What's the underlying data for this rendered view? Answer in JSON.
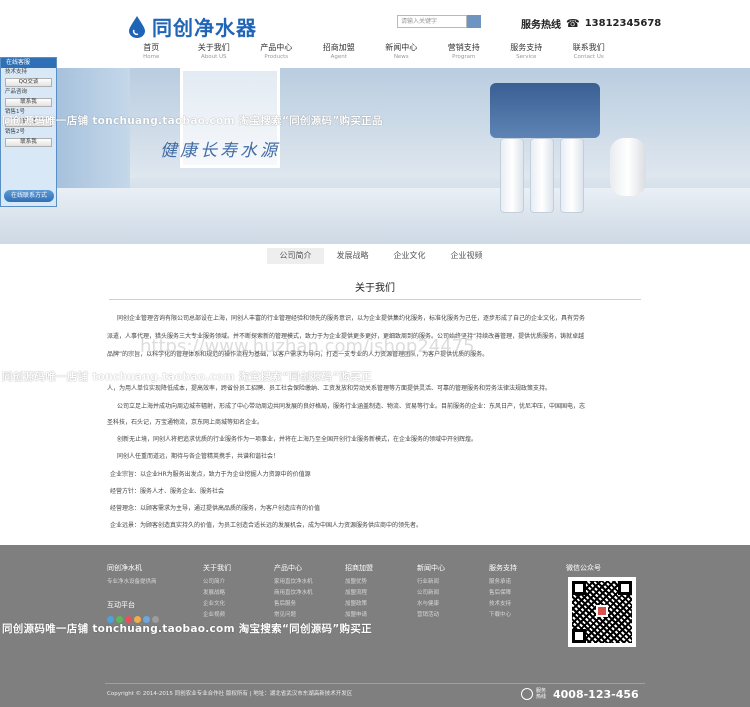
{
  "header": {
    "brand": "同创净水器",
    "search_placeholder": "请输入关键字",
    "hotline_label": "服务热线",
    "hotline_number": "13812345678"
  },
  "nav": [
    {
      "cn": "首页",
      "en": "Home"
    },
    {
      "cn": "关于我们",
      "en": "About US"
    },
    {
      "cn": "产品中心",
      "en": "Products"
    },
    {
      "cn": "招商加盟",
      "en": "Agent"
    },
    {
      "cn": "新闻中心",
      "en": "News"
    },
    {
      "cn": "营销支持",
      "en": "Program"
    },
    {
      "cn": "服务支持",
      "en": "Service"
    },
    {
      "cn": "联系我们",
      "en": "Contact Us"
    }
  ],
  "banner": {
    "slogan": "健康长寿水源"
  },
  "float_panel": {
    "title": "在线客服",
    "rows": [
      "技术支持",
      "QQ交谈",
      "产品咨询",
      "联系我",
      "销售1号",
      "联系我",
      "销售2号",
      "联系我"
    ],
    "footer": "在线联系方式"
  },
  "subtabs": [
    "公司简介",
    "发展战略",
    "企业文化",
    "企业视频"
  ],
  "content": {
    "title": "关于我们",
    "paragraphs": [
      "同创企业管理咨询有限公司总部设在上海，同创人丰富的行业管理经验和领先的服务意识，以为企业提供集约化服务，标准化服务为己任，逐步形成了自己的企业文化，具有劳务",
      "派遣，人事代理，猎头服务三大专业服务领域。并不断探索新的管理模式，致力于为企业提供更多更好，更细致周到的服务。公司始终坚持“持续改善管理，提供优质服务，铸就卓越",
      "品牌”的宗旨，以科学化的管理体系和规范的操作流程为基础，以客户需求为导向，打造一支专业的人力资源管理团队，为客户提供优质的服务。",
      "人，为用人单位实现降低成本，提高效率，跨省份员工招聘、员工社会保险缴纳、工资发放和劳动关系管理等方面提供灵活、可靠的管理服务和劳务法律法规政策支持。",
      "公司立足上海并成功向周边城市辐射，形成了中心带动周边共同发展的良好格局，服务行业涵盖制造、物流、贸易等行业。目前服务的企业：东风日产，优尼冲压，中国国电，志",
      "圣科技，石头记，万宝通物流，京东网上商城等知名企业。",
      "创新无止境，同创人将把追求优质的行业服务作为一项事业，并将在上海乃至全国开创行业服务新模式，在企业服务的领域中开创辉煌。",
      "同创人任重而道远，期待与各企管精英携手，共谱和谐社会！",
      "企业宗旨：以企业HR为服务出发点，致力于为企业挖掘人力资源中的价值源",
      "经营方针：服务人才、服务企业、服务社会",
      "经营理念：以顾客需求为主导，通过提供高品质的服务，为客户创造应有的价值",
      "企业远景：为顾客创造真实持久的价值，为员工创造合适长远的发展机会，成为中国人力资源服务供应商中的领先者。"
    ]
  },
  "watermarks": {
    "line1": "同创源码唯一店铺  tonchuang.taobao.com  淘宝搜索“同创源码”购买正品",
    "line2": "同创源码唯一店铺  tonchuang.taobao.com  淘宝搜索“同创源码”购买正",
    "url": "https://www.huzhan.com/ishop24475"
  },
  "footer": {
    "brand": "同创净水机",
    "brand_sub": "专业净水设备提供商",
    "interactive": "互动平台",
    "columns": [
      {
        "title": "关于我们",
        "links": [
          "公司简介",
          "发展战略",
          "企业文化",
          "企业视频"
        ]
      },
      {
        "title": "产品中心",
        "links": [
          "家用直饮净水机",
          "商用直饮净水机",
          "售后服务",
          "常见问题"
        ]
      },
      {
        "title": "招商加盟",
        "links": [
          "加盟优势",
          "加盟流程",
          "加盟政策",
          "加盟申请"
        ]
      },
      {
        "title": "新闻中心",
        "links": [
          "行业新闻",
          "公司新闻",
          "水与健康",
          "营销活动"
        ]
      },
      {
        "title": "服务支持",
        "links": [
          "服务承诺",
          "售后保障",
          "技术支持",
          "下载中心"
        ]
      }
    ],
    "wechat": "微信公众号",
    "copyright": "Copyright © 2014-2015 同创农业专业合作社 版权所有 | 地址：湖北省武汉市东湖高新技术开发区",
    "hotline_label": "服务热线",
    "hotline_number": "4008-123-456"
  },
  "colors": {
    "brand": "#1f64b6",
    "footer_bg": "#7f7f7f"
  }
}
